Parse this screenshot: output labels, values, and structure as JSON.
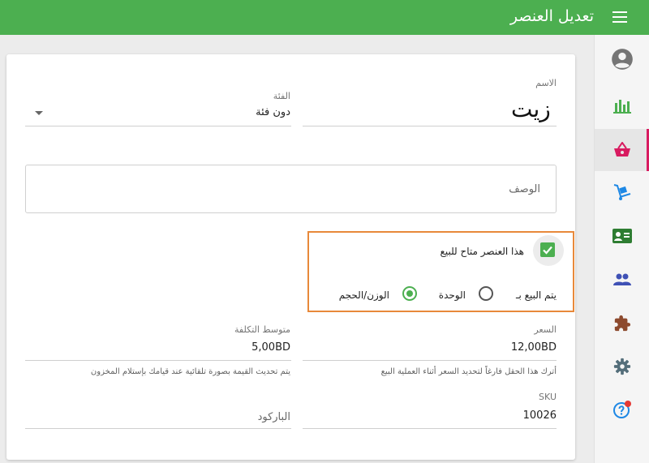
{
  "header": {
    "title": "تعديل العنصر",
    "menu_icon": "hamburger-menu-icon",
    "bg_color": "#4caf50"
  },
  "sidebar": {
    "items": [
      {
        "name": "account",
        "icon": "account-circle-icon",
        "color": "#757575",
        "active": false
      },
      {
        "name": "reports",
        "icon": "bar-chart-icon",
        "color": "#4caf50",
        "active": false
      },
      {
        "name": "items",
        "icon": "basket-icon",
        "color": "#d81b60",
        "active": true
      },
      {
        "name": "inventory",
        "icon": "dolly-icon",
        "color": "#1e88e5",
        "active": false
      },
      {
        "name": "contacts",
        "icon": "id-card-icon",
        "color": "#2e7d32",
        "active": false
      },
      {
        "name": "users",
        "icon": "people-icon",
        "color": "#3f51b5",
        "active": false
      },
      {
        "name": "extensions",
        "icon": "puzzle-icon",
        "color": "#8d4a2e",
        "active": false
      },
      {
        "name": "settings",
        "icon": "gear-icon",
        "color": "#546e7a",
        "active": false
      },
      {
        "name": "help",
        "icon": "help-icon",
        "color": "#1e88e5",
        "active": false
      }
    ],
    "active_color": "#d81b60"
  },
  "form": {
    "name": {
      "label": "الاسم",
      "value": "زيت"
    },
    "category": {
      "label": "الفئة",
      "value": "دون فئة"
    },
    "description": {
      "placeholder": "الوصف"
    },
    "available": {
      "label": "هذا العنصر متاح للبيع",
      "checked": true
    },
    "sold_by": {
      "label": "يتم البيع بـ",
      "options": [
        {
          "label": "الوحدة",
          "checked": false
        },
        {
          "label": "الوزن/الحجم",
          "checked": true
        }
      ]
    },
    "price": {
      "label": "السعر",
      "value": "12,00BD",
      "hint": "أترك هذا الحقل فارغاً لتحديد السعر أثناء العملية البيع"
    },
    "cost": {
      "label": "متوسط التكلفة",
      "value": "5,00BD",
      "hint": "يتم تحديث القيمة بصورة تلقائية عند قيامك بإستلام المخزون"
    },
    "sku": {
      "label": "SKU",
      "value": "10026"
    },
    "barcode": {
      "placeholder": "الباركود"
    }
  },
  "accent_color": "#4caf50",
  "highlight_color": "#e8893a"
}
